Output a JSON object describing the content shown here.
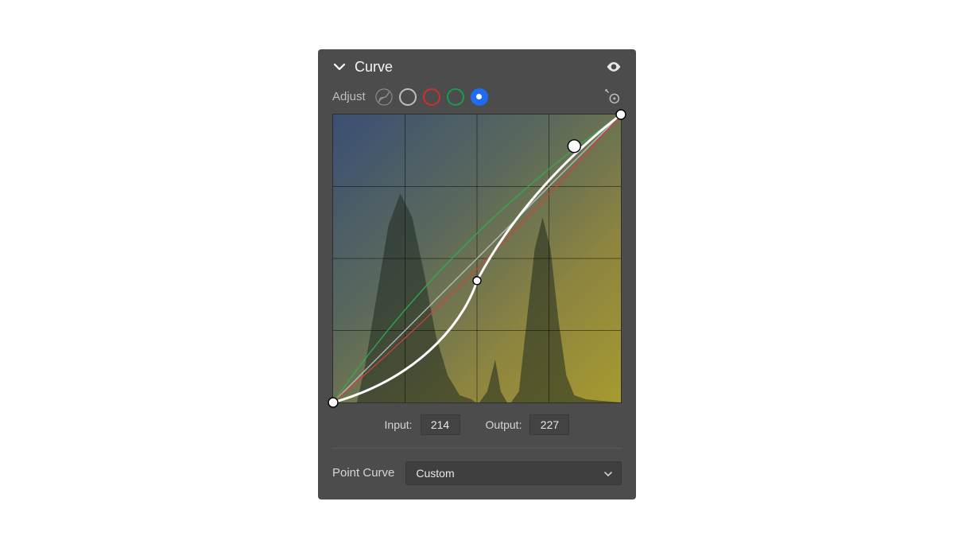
{
  "panel": {
    "title": "Curve"
  },
  "adjust": {
    "label": "Adjust"
  },
  "channels": {
    "active": "blue"
  },
  "io": {
    "input_label": "Input:",
    "input_value": "214",
    "output_label": "Output:",
    "output_value": "227"
  },
  "preset": {
    "label": "Point Curve",
    "value": "Custom"
  },
  "chart_data": {
    "type": "line",
    "xlim": [
      0,
      255
    ],
    "ylim": [
      0,
      255
    ],
    "xlabel": "Input",
    "ylabel": "Output",
    "grid": "4x4",
    "series": [
      {
        "name": "blue",
        "active": true,
        "points": [
          [
            0,
            0
          ],
          [
            128,
            108
          ],
          [
            214,
            227
          ],
          [
            255,
            255
          ]
        ]
      },
      {
        "name": "green",
        "active": false,
        "points": [
          [
            0,
            0
          ],
          [
            128,
            140
          ],
          [
            255,
            255
          ]
        ]
      },
      {
        "name": "red",
        "active": false,
        "points": [
          [
            0,
            0
          ],
          [
            128,
            120
          ],
          [
            255,
            255
          ]
        ]
      },
      {
        "name": "rgb",
        "active": false,
        "points": [
          [
            0,
            0
          ],
          [
            255,
            255
          ]
        ]
      }
    ],
    "selected_point": {
      "x": 214,
      "y": 227
    }
  }
}
